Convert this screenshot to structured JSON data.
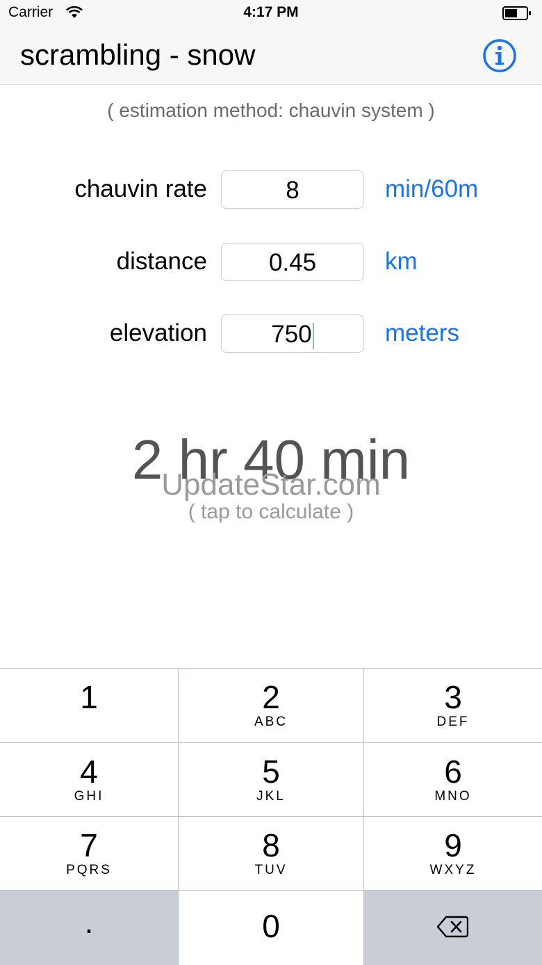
{
  "status_bar": {
    "carrier": "Carrier",
    "time": "4:17 PM"
  },
  "nav": {
    "title": "scrambling - snow"
  },
  "method_text": "( estimation method: chauvin system )",
  "fields": [
    {
      "label": "chauvin rate",
      "value": "8",
      "unit": "min/60m"
    },
    {
      "label": "distance",
      "value": "0.45",
      "unit": "km"
    },
    {
      "label": "elevation",
      "value": "750",
      "unit": "meters"
    }
  ],
  "result": {
    "value": "2 hr 40 min",
    "hint": "( tap to calculate )"
  },
  "watermark": "UpdateStar.com",
  "keypad": {
    "keys": [
      {
        "num": "1",
        "letters": ""
      },
      {
        "num": "2",
        "letters": "ABC"
      },
      {
        "num": "3",
        "letters": "DEF"
      },
      {
        "num": "4",
        "letters": "GHI"
      },
      {
        "num": "5",
        "letters": "JKL"
      },
      {
        "num": "6",
        "letters": "MNO"
      },
      {
        "num": "7",
        "letters": "PQRS"
      },
      {
        "num": "8",
        "letters": "TUV"
      },
      {
        "num": "9",
        "letters": "WXYZ"
      },
      {
        "num": ".",
        "letters": ""
      },
      {
        "num": "0",
        "letters": ""
      }
    ]
  },
  "colors": {
    "accent": "#1a73e8",
    "keypad_gray": "#c9ced6"
  }
}
